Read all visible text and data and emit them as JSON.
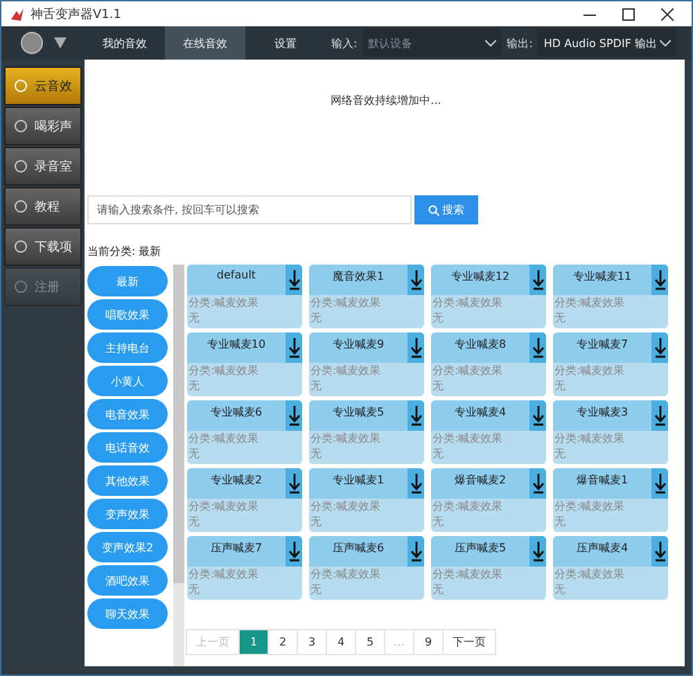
{
  "window": {
    "title": "神舌变声器V1.1"
  },
  "toolbar": {
    "tabs": [
      {
        "label": "我的音效",
        "selected": false
      },
      {
        "label": "在线音效",
        "selected": true
      },
      {
        "label": "设置",
        "selected": false
      }
    ],
    "input": {
      "label": "输入:",
      "placeholder": "默认设备"
    },
    "output": {
      "label": "输出:",
      "value": "HD Audio SPDIF 输出"
    }
  },
  "sidebar": {
    "items": [
      {
        "label": "云音效",
        "selected": true,
        "disabled": false
      },
      {
        "label": "喝彩声",
        "selected": false,
        "disabled": false
      },
      {
        "label": "录音室",
        "selected": false,
        "disabled": false
      },
      {
        "label": "教程",
        "selected": false,
        "disabled": false
      },
      {
        "label": "下载项",
        "selected": false,
        "disabled": false
      },
      {
        "label": "注册",
        "selected": false,
        "disabled": true
      }
    ]
  },
  "notice": "网络音效持续增加中...",
  "search": {
    "placeholder": "请输入搜索条件, 按回车可以搜索",
    "button": "搜索"
  },
  "current_category": "当前分类: 最新",
  "categories": [
    "最新",
    "唱歌效果",
    "主持电台",
    "小黄人",
    "电音效果",
    "电话音效",
    "其他效果",
    "变声效果",
    "变声效果2",
    "酒吧效果",
    "聊天效果"
  ],
  "effects": [
    {
      "title": "default",
      "category": "分类:喊麦效果",
      "note": "无"
    },
    {
      "title": "魔音效果1",
      "category": "分类:喊麦效果",
      "note": "无"
    },
    {
      "title": "专业喊麦12",
      "category": "分类:喊麦效果",
      "note": "无"
    },
    {
      "title": "专业喊麦11",
      "category": "分类:喊麦效果",
      "note": "无"
    },
    {
      "title": "专业喊麦10",
      "category": "分类:喊麦效果",
      "note": "无"
    },
    {
      "title": "专业喊麦9",
      "category": "分类:喊麦效果",
      "note": "无"
    },
    {
      "title": "专业喊麦8",
      "category": "分类:喊麦效果",
      "note": "无"
    },
    {
      "title": "专业喊麦7",
      "category": "分类:喊麦效果",
      "note": "无"
    },
    {
      "title": "专业喊麦6",
      "category": "分类:喊麦效果",
      "note": "无"
    },
    {
      "title": "专业喊麦5",
      "category": "分类:喊麦效果",
      "note": "无"
    },
    {
      "title": "专业喊麦4",
      "category": "分类:喊麦效果",
      "note": "无"
    },
    {
      "title": "专业喊麦3",
      "category": "分类:喊麦效果",
      "note": "无"
    },
    {
      "title": "专业喊麦2",
      "category": "分类:喊麦效果",
      "note": "无"
    },
    {
      "title": "专业喊麦1",
      "category": "分类:喊麦效果",
      "note": "无"
    },
    {
      "title": "爆音喊麦2",
      "category": "分类:喊麦效果",
      "note": "无"
    },
    {
      "title": "爆音喊麦1",
      "category": "分类:喊麦效果",
      "note": "无"
    },
    {
      "title": "压声喊麦7",
      "category": "分类:喊麦效果",
      "note": "无"
    },
    {
      "title": "压声喊麦6",
      "category": "分类:喊麦效果",
      "note": "无"
    },
    {
      "title": "压声喊麦5",
      "category": "分类:喊麦效果",
      "note": "无"
    },
    {
      "title": "压声喊麦4",
      "category": "分类:喊麦效果",
      "note": "无"
    }
  ],
  "pagination": [
    {
      "label": "上一页",
      "kind": "prev",
      "selected": false,
      "disabled": true
    },
    {
      "label": "1",
      "kind": "page",
      "selected": true,
      "disabled": false
    },
    {
      "label": "2",
      "kind": "page",
      "selected": false,
      "disabled": false
    },
    {
      "label": "3",
      "kind": "page",
      "selected": false,
      "disabled": false
    },
    {
      "label": "4",
      "kind": "page",
      "selected": false,
      "disabled": false
    },
    {
      "label": "5",
      "kind": "page",
      "selected": false,
      "disabled": false
    },
    {
      "label": "...",
      "kind": "gap",
      "selected": false,
      "disabled": true
    },
    {
      "label": "9",
      "kind": "page",
      "selected": false,
      "disabled": false
    },
    {
      "label": "下一页",
      "kind": "next",
      "selected": false,
      "disabled": false
    }
  ]
}
